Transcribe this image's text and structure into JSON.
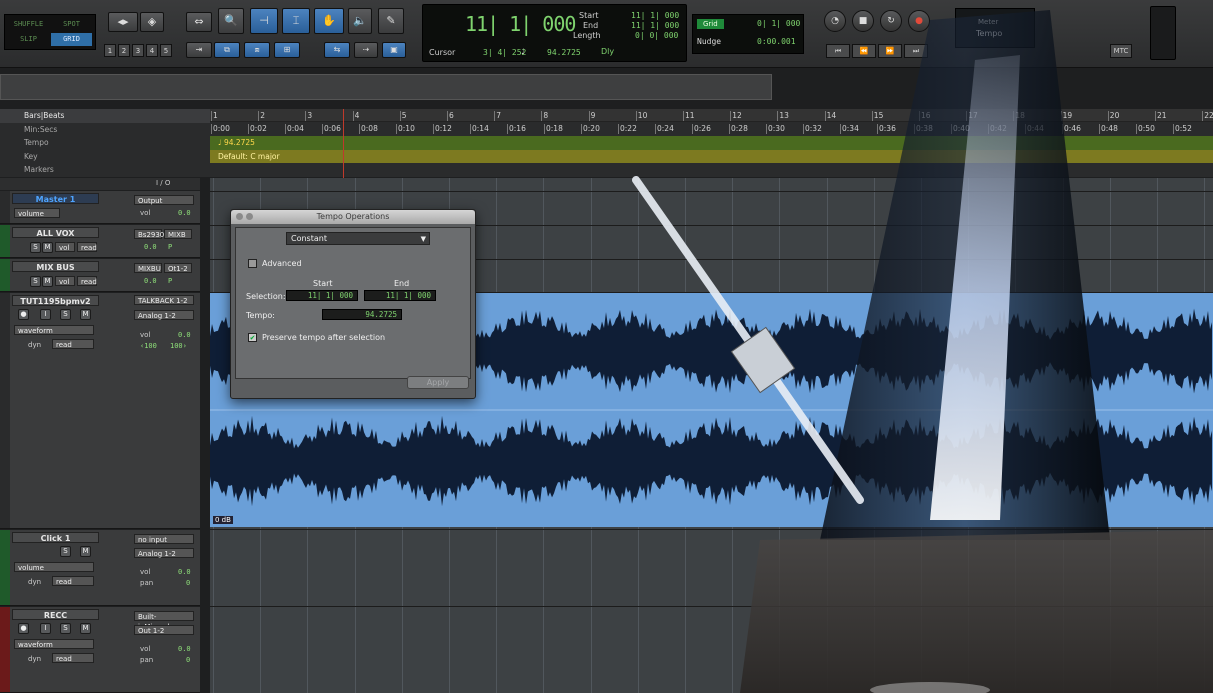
{
  "toolbar": {
    "modes": [
      "SHUFFLE",
      "SPOT",
      "SLIP",
      "GRID"
    ],
    "active_mode": "GRID",
    "zoom_presets": [
      "1",
      "2",
      "3",
      "4",
      "5"
    ],
    "counter": {
      "main": "11| 1| 000",
      "start_label": "Start",
      "end_label": "End",
      "length_label": "Length",
      "start": "11| 1| 000",
      "end": "11| 1| 000",
      "length": "0| 0| 000",
      "cursor_label": "Cursor",
      "cursor": "3| 4| 252",
      "tempo": "94.2725",
      "dly_label": "Dly"
    },
    "grid": {
      "grid_label": "Grid",
      "grid_value": "0| 1| 000",
      "nudge_label": "Nudge",
      "nudge_value": "0:00.001"
    },
    "meter_label": "Meter",
    "tempo_label": "Tempo",
    "mtc_label": "MTC"
  },
  "rulers": {
    "labels": [
      "Bars|Beats",
      "Min:Secs",
      "Tempo",
      "Key",
      "Markers"
    ],
    "bars": [
      "1",
      "2",
      "3",
      "4",
      "5",
      "6",
      "7",
      "8",
      "9",
      "10",
      "11",
      "12",
      "13",
      "14",
      "15",
      "16",
      "17",
      "18",
      "19",
      "20",
      "21",
      "22"
    ],
    "mins": [
      "0:00",
      "0:02",
      "0:04",
      "0:06",
      "0:08",
      "0:10",
      "0:12",
      "0:14",
      "0:16",
      "0:18",
      "0:20",
      "0:22",
      "0:24",
      "0:26",
      "0:28",
      "0:30",
      "0:32",
      "0:34",
      "0:36",
      "0:38",
      "0:40",
      "0:42",
      "0:44",
      "0:46",
      "0:48",
      "0:50",
      "0:52"
    ],
    "tempo_value": "94.2725",
    "key_value": "Default: C major"
  },
  "tracks_header": {
    "io_label": "I / O"
  },
  "tracks": [
    {
      "name": "Master 1",
      "output": "Output",
      "view": "volume",
      "vol_label": "vol",
      "vol": "0.0"
    },
    {
      "name": "ALL VOX",
      "input": "Bs2930",
      "output": "MIXB",
      "vol_label": "vol",
      "read": "read",
      "vol": "0.0",
      "p": "P"
    },
    {
      "name": "MIX BUS",
      "input": "MIXBU",
      "output": "Ot1-2",
      "vol_label": "vol",
      "read": "read",
      "vol": "0.0",
      "p": "P"
    },
    {
      "name": "TUT1195bpmv2",
      "input": "TALKBACK 1-2",
      "output": "Analog 1-2",
      "view": "waveform",
      "dyn": "dyn",
      "read": "read",
      "vol_label": "vol",
      "vol": "0.0",
      "pan_l": "‹100",
      "pan_r": "100›",
      "clip_gain": "0 dB"
    },
    {
      "name": "Click 1",
      "input": "no input",
      "output": "Analog 1-2",
      "view": "volume",
      "dyn": "dyn",
      "read": "read",
      "vol_label": "vol",
      "pan_label": "pan",
      "vol": "0.0",
      "pan": "0"
    },
    {
      "name": "RECC",
      "input": "Built-inMicrophone",
      "output": "Out 1-2",
      "view": "waveform",
      "dyn": "dyn",
      "read": "read",
      "vol_label": "vol",
      "pan_label": "pan",
      "vol": "0.0",
      "pan": "0"
    }
  ],
  "dialog": {
    "title": "Tempo Operations",
    "mode": "Constant",
    "advanced_label": "Advanced",
    "start_label": "Start",
    "end_label": "End",
    "selection_label": "Selection:",
    "selection_start": "11| 1| 000",
    "selection_end": "11| 1| 000",
    "tempo_label": "Tempo:",
    "tempo_value": "94.2725",
    "preserve_label": "Preserve tempo after selection",
    "preserve_checked": true,
    "apply_label": "Apply"
  },
  "colors": {
    "waveform_bg": "#6a9fd8",
    "waveform_fg": "#0f1e36",
    "tempo_lane": "#4a6a1f",
    "key_lane": "#7d7a20",
    "counter_green": "#7fd36e"
  }
}
